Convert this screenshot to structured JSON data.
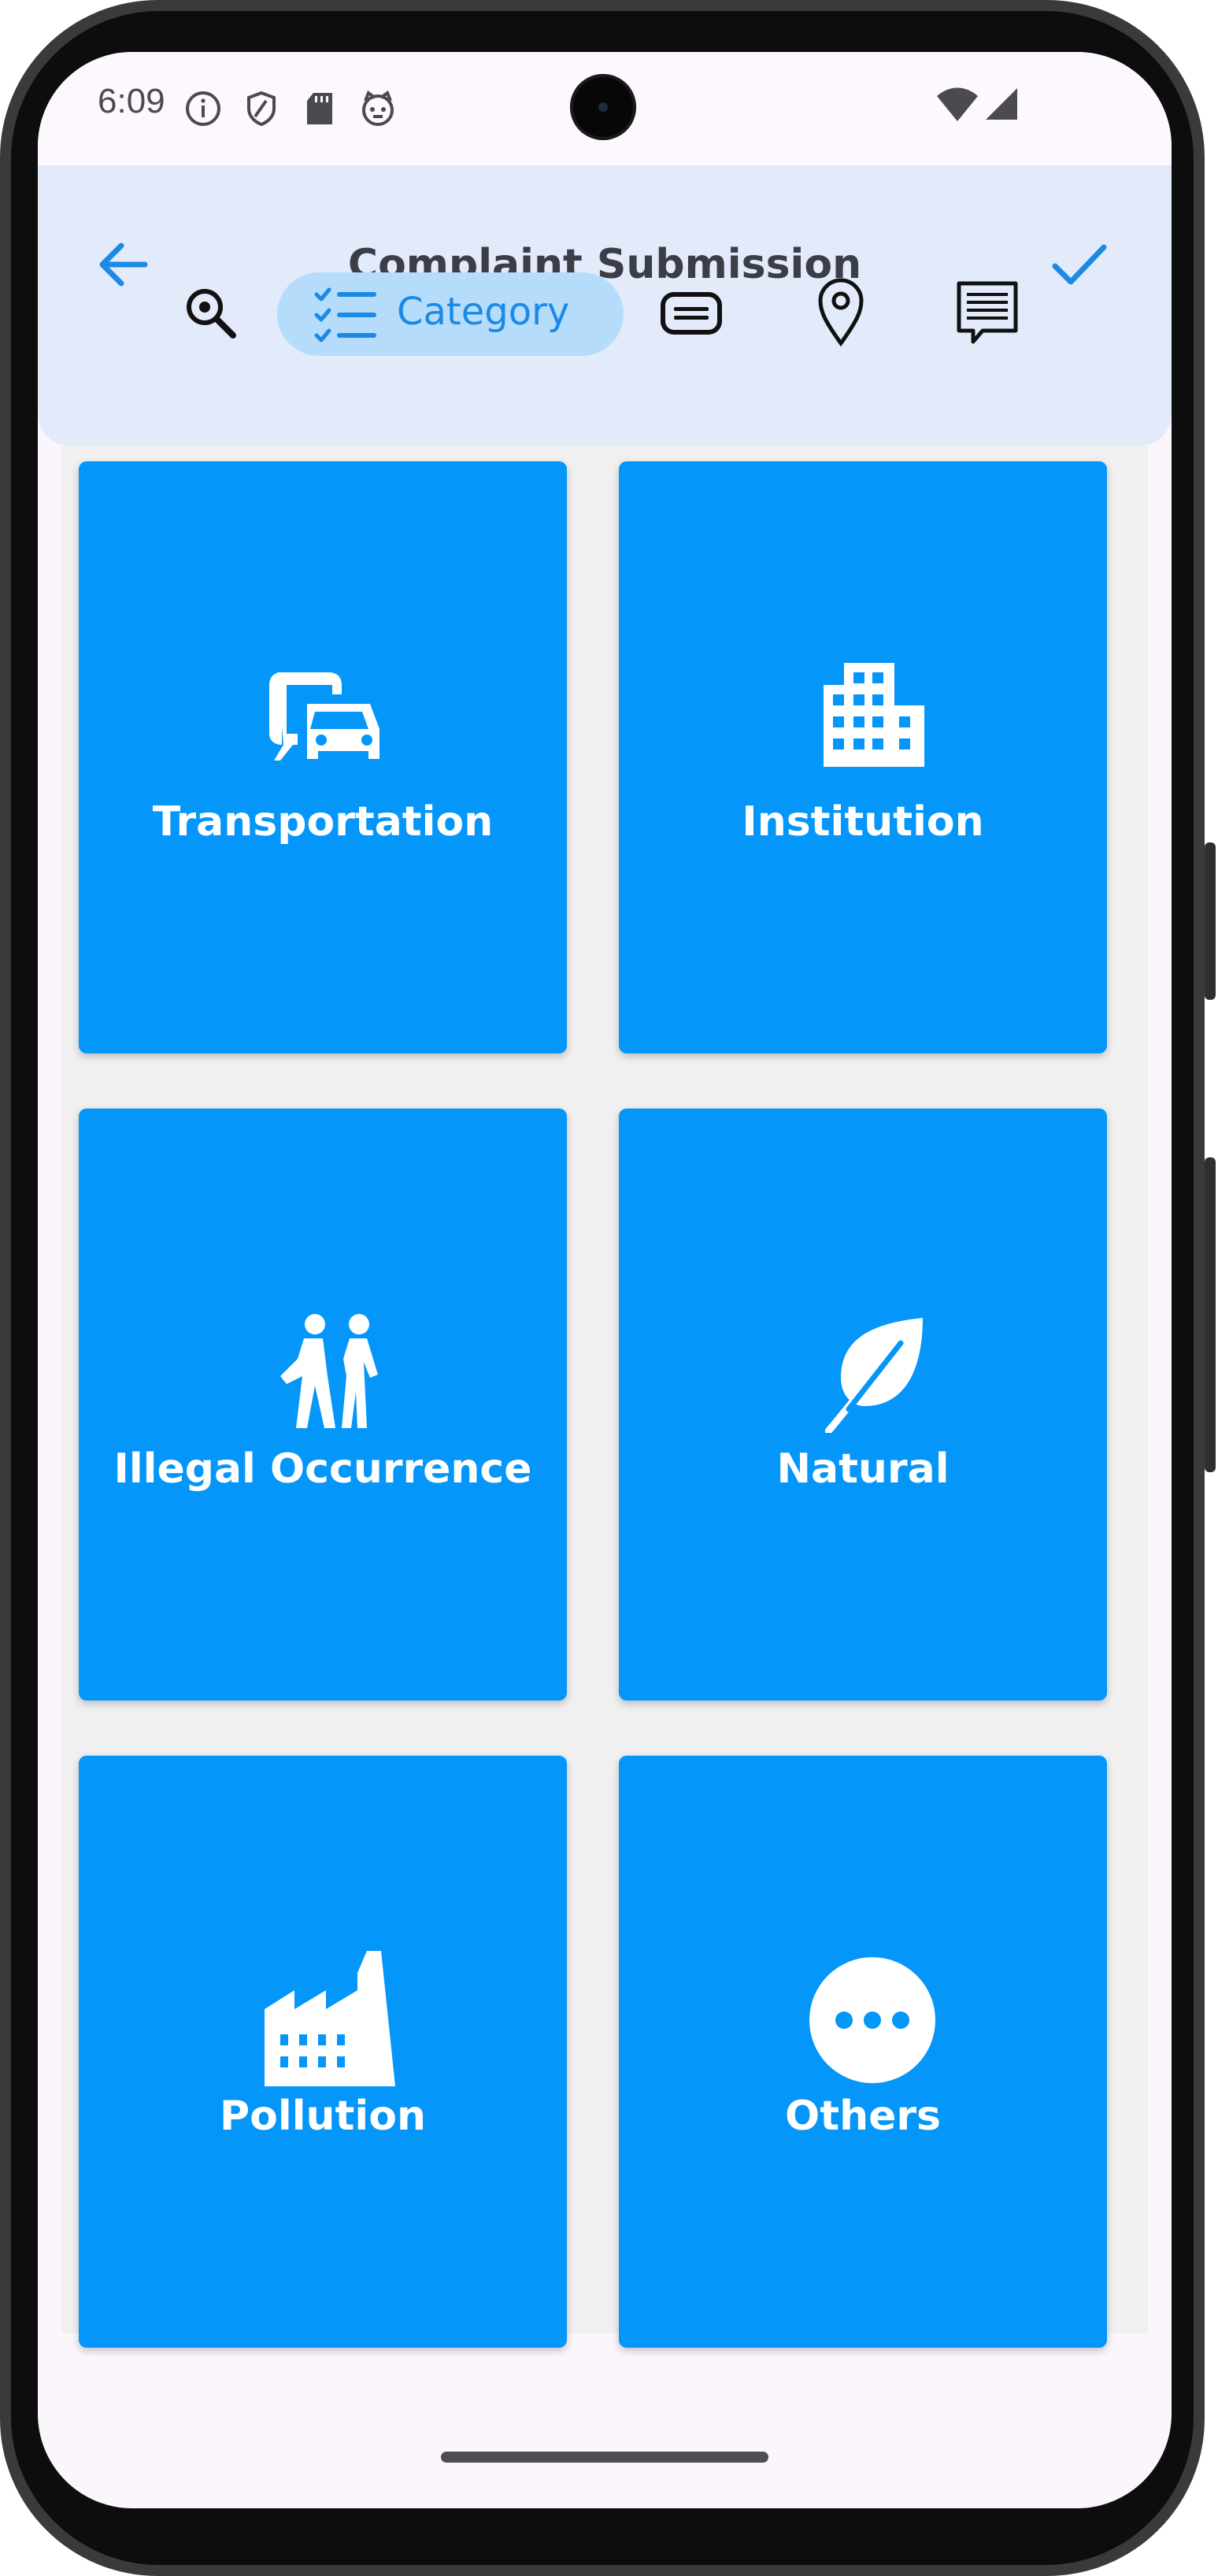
{
  "status_bar": {
    "time": "6:09",
    "icons": [
      "info-icon",
      "shield-icon",
      "sd-card-icon",
      "cat-face-icon",
      "wifi-icon",
      "signal-icon"
    ]
  },
  "app_bar": {
    "title": "Complaint Submission",
    "back_icon": "arrow-left-icon",
    "confirm_icon": "check-icon"
  },
  "steps": [
    {
      "icon": "search-icon",
      "label": ""
    },
    {
      "icon": "checklist-icon",
      "label": "Category",
      "selected": true
    },
    {
      "icon": "detail-icon",
      "label": ""
    },
    {
      "icon": "location-pin-icon",
      "label": ""
    },
    {
      "icon": "summary-icon",
      "label": ""
    }
  ],
  "categories": [
    {
      "label": "Transportation",
      "icon": "transportation-icon"
    },
    {
      "label": "Institution",
      "icon": "building-icon"
    },
    {
      "label": "Illegal Occurrence",
      "icon": "people-walking-icon"
    },
    {
      "label": "Natural",
      "icon": "leaf-icon"
    },
    {
      "label": "Pollution",
      "icon": "factory-icon"
    },
    {
      "label": "Others",
      "icon": "more-dots-icon"
    }
  ],
  "colors": {
    "accent": "#1b89e6",
    "card": "#0496f8",
    "app_bar": "#e3ebfb",
    "selected_tab": "#b6dcfb",
    "title": "#3b3d47"
  }
}
